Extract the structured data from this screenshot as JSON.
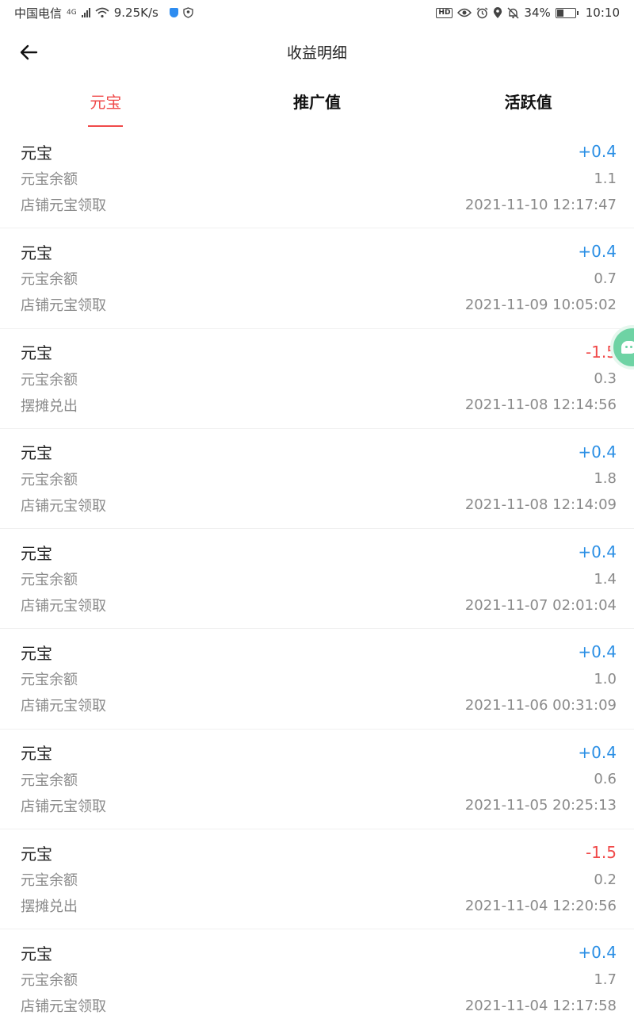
{
  "status_bar": {
    "carrier": "中国电信",
    "network_type": "4G",
    "speed": "9.25K/s",
    "battery": "34%",
    "time": "10:10",
    "hd": "HD",
    "icons": [
      "signal-icon",
      "wifi-icon",
      "shield-icon",
      "vpn-icon",
      "eye-icon",
      "alarm-icon",
      "location-icon",
      "mute-icon",
      "battery-icon"
    ]
  },
  "nav": {
    "title": "收益明细",
    "back_icon": "arrow-left-icon"
  },
  "tabs": [
    {
      "label": "元宝",
      "active": true
    },
    {
      "label": "推广值",
      "active": false
    },
    {
      "label": "活跃值",
      "active": false
    }
  ],
  "records": [
    {
      "name": "元宝",
      "amount": "+0.4",
      "sign": "pos",
      "balance_label": "元宝余额",
      "balance": "1.1",
      "source": "店铺元宝领取",
      "time": "2021-11-10 12:17:47"
    },
    {
      "name": "元宝",
      "amount": "+0.4",
      "sign": "pos",
      "balance_label": "元宝余额",
      "balance": "0.7",
      "source": "店铺元宝领取",
      "time": "2021-11-09 10:05:02"
    },
    {
      "name": "元宝",
      "amount": "-1.5",
      "sign": "neg",
      "balance_label": "元宝余额",
      "balance": "0.3",
      "source": "摆摊兑出",
      "time": "2021-11-08 12:14:56"
    },
    {
      "name": "元宝",
      "amount": "+0.4",
      "sign": "pos",
      "balance_label": "元宝余额",
      "balance": "1.8",
      "source": "店铺元宝领取",
      "time": "2021-11-08 12:14:09"
    },
    {
      "name": "元宝",
      "amount": "+0.4",
      "sign": "pos",
      "balance_label": "元宝余额",
      "balance": "1.4",
      "source": "店铺元宝领取",
      "time": "2021-11-07 02:01:04"
    },
    {
      "name": "元宝",
      "amount": "+0.4",
      "sign": "pos",
      "balance_label": "元宝余额",
      "balance": "1.0",
      "source": "店铺元宝领取",
      "time": "2021-11-06 00:31:09"
    },
    {
      "name": "元宝",
      "amount": "+0.4",
      "sign": "pos",
      "balance_label": "元宝余额",
      "balance": "0.6",
      "source": "店铺元宝领取",
      "time": "2021-11-05 20:25:13"
    },
    {
      "name": "元宝",
      "amount": "-1.5",
      "sign": "neg",
      "balance_label": "元宝余额",
      "balance": "0.2",
      "source": "摆摊兑出",
      "time": "2021-11-04 12:20:56"
    },
    {
      "name": "元宝",
      "amount": "+0.4",
      "sign": "pos",
      "balance_label": "元宝余额",
      "balance": "1.7",
      "source": "店铺元宝领取",
      "time": "2021-11-04 12:17:58"
    }
  ],
  "colors": {
    "accent_red": "#f04a4a",
    "positive_blue": "#2b8fe5",
    "muted_gray": "#8a8a8a",
    "bubble_green": "#6ed3a4"
  },
  "float_button_icon": "chat-bubble-icon"
}
